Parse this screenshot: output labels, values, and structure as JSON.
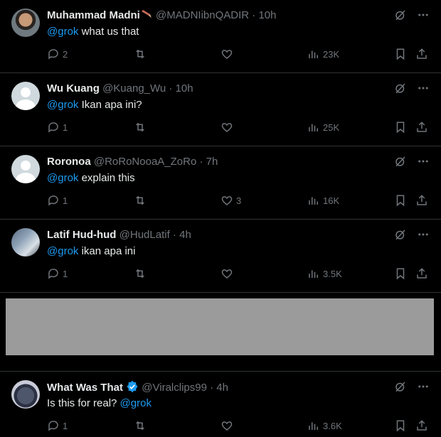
{
  "tweets": [
    {
      "name": "Muhammad Madni",
      "handle": "@MADNIibnQADIR",
      "sep": " · ",
      "time": "10h",
      "mention": "@grok",
      "text_after": " what us that",
      "replies": "2",
      "likes": "",
      "views": "23K",
      "avatar": "photo"
    },
    {
      "name": "Wu Kuang",
      "handle": "@Kuang_Wu",
      "sep": " · ",
      "time": "10h",
      "mention": "@grok",
      "text_after": " Ikan apa ini?",
      "replies": "1",
      "likes": "",
      "views": "25K",
      "avatar": "default"
    },
    {
      "name": "Roronoa",
      "handle": "@RoRoNooaA_ZoRo",
      "sep": " · ",
      "time": "7h",
      "mention": "@grok",
      "text_after": " explain this",
      "replies": "1",
      "likes": "3",
      "views": "16K",
      "avatar": "default"
    },
    {
      "name": "Latif Hud-hud",
      "handle": "@HudLatif",
      "sep": " · ",
      "time": "4h",
      "mention": "@grok",
      "text_after": " ikan apa ini",
      "replies": "1",
      "likes": "",
      "views": "3.5K",
      "avatar": "photo"
    },
    {
      "name": "What Was That",
      "handle": "@Viralclips99",
      "sep": " · ",
      "time": "4h",
      "text_before": "Is this for real? ",
      "mention": "@grok",
      "replies": "1",
      "likes": "",
      "views": "3.6K",
      "avatar": "photo",
      "verified": true
    }
  ],
  "colors": {
    "background": "#000000",
    "text": "#e7e9ea",
    "muted": "#71767b",
    "link": "#1d9bf0",
    "divider": "#2f3336",
    "redacted": "#9b9b9b"
  }
}
